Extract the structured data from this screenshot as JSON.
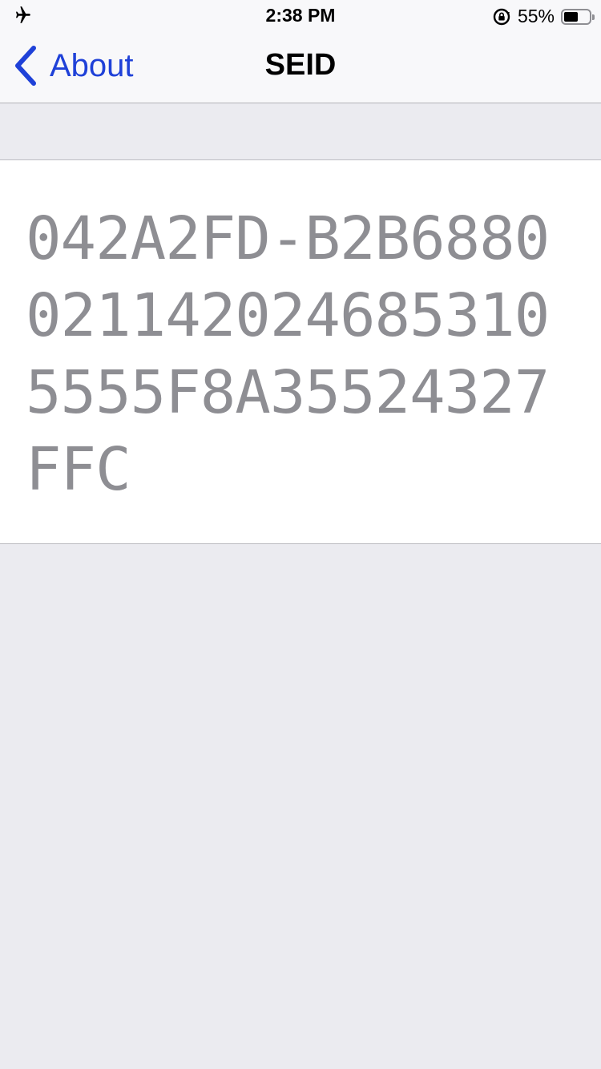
{
  "status_bar": {
    "time": "2:38 PM",
    "battery_percent_label": "55%",
    "battery_level": 0.55,
    "icons": [
      "airplane-mode-icon",
      "orientation-lock-icon",
      "battery-icon"
    ]
  },
  "nav": {
    "back_label": "About",
    "title": "SEID"
  },
  "content": {
    "seid_value": "042A2FD-B2B68800211420246853105555F8A35524327FFC"
  },
  "colors": {
    "accent": "#1f41d8",
    "background": "#ebebf0",
    "card": "#ffffff",
    "value_text": "#8e8e93"
  }
}
